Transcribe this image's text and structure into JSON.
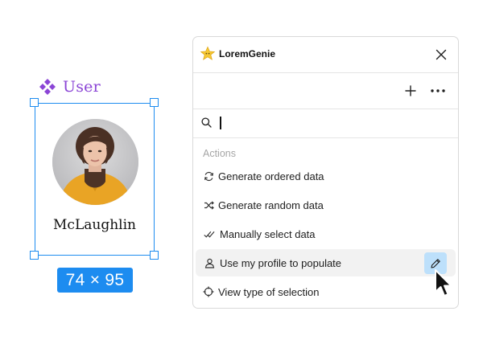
{
  "component": {
    "label": "User",
    "label_icon": "component-icon",
    "person_name": "McLaughlin",
    "size_badge": "74 × 95"
  },
  "panel": {
    "title": "LoremGenie",
    "logo_icon": "star-logo-icon",
    "search": {
      "value": "",
      "placeholder": ""
    },
    "section_title": "Actions",
    "items": [
      {
        "label": "Generate ordered data",
        "icon": "refresh-icon"
      },
      {
        "label": "Generate random data",
        "icon": "shuffle-icon"
      },
      {
        "label": "Manually select data",
        "icon": "double-check-icon"
      },
      {
        "label": "Use my profile to populate",
        "icon": "user-icon"
      },
      {
        "label": "View type of selection",
        "icon": "crosshair-icon"
      }
    ]
  },
  "colors": {
    "accent": "#1d8cf0",
    "component_purple": "#8b45d6",
    "hover_row": "#f2f2f2",
    "edit_button": "#bde0fb"
  }
}
